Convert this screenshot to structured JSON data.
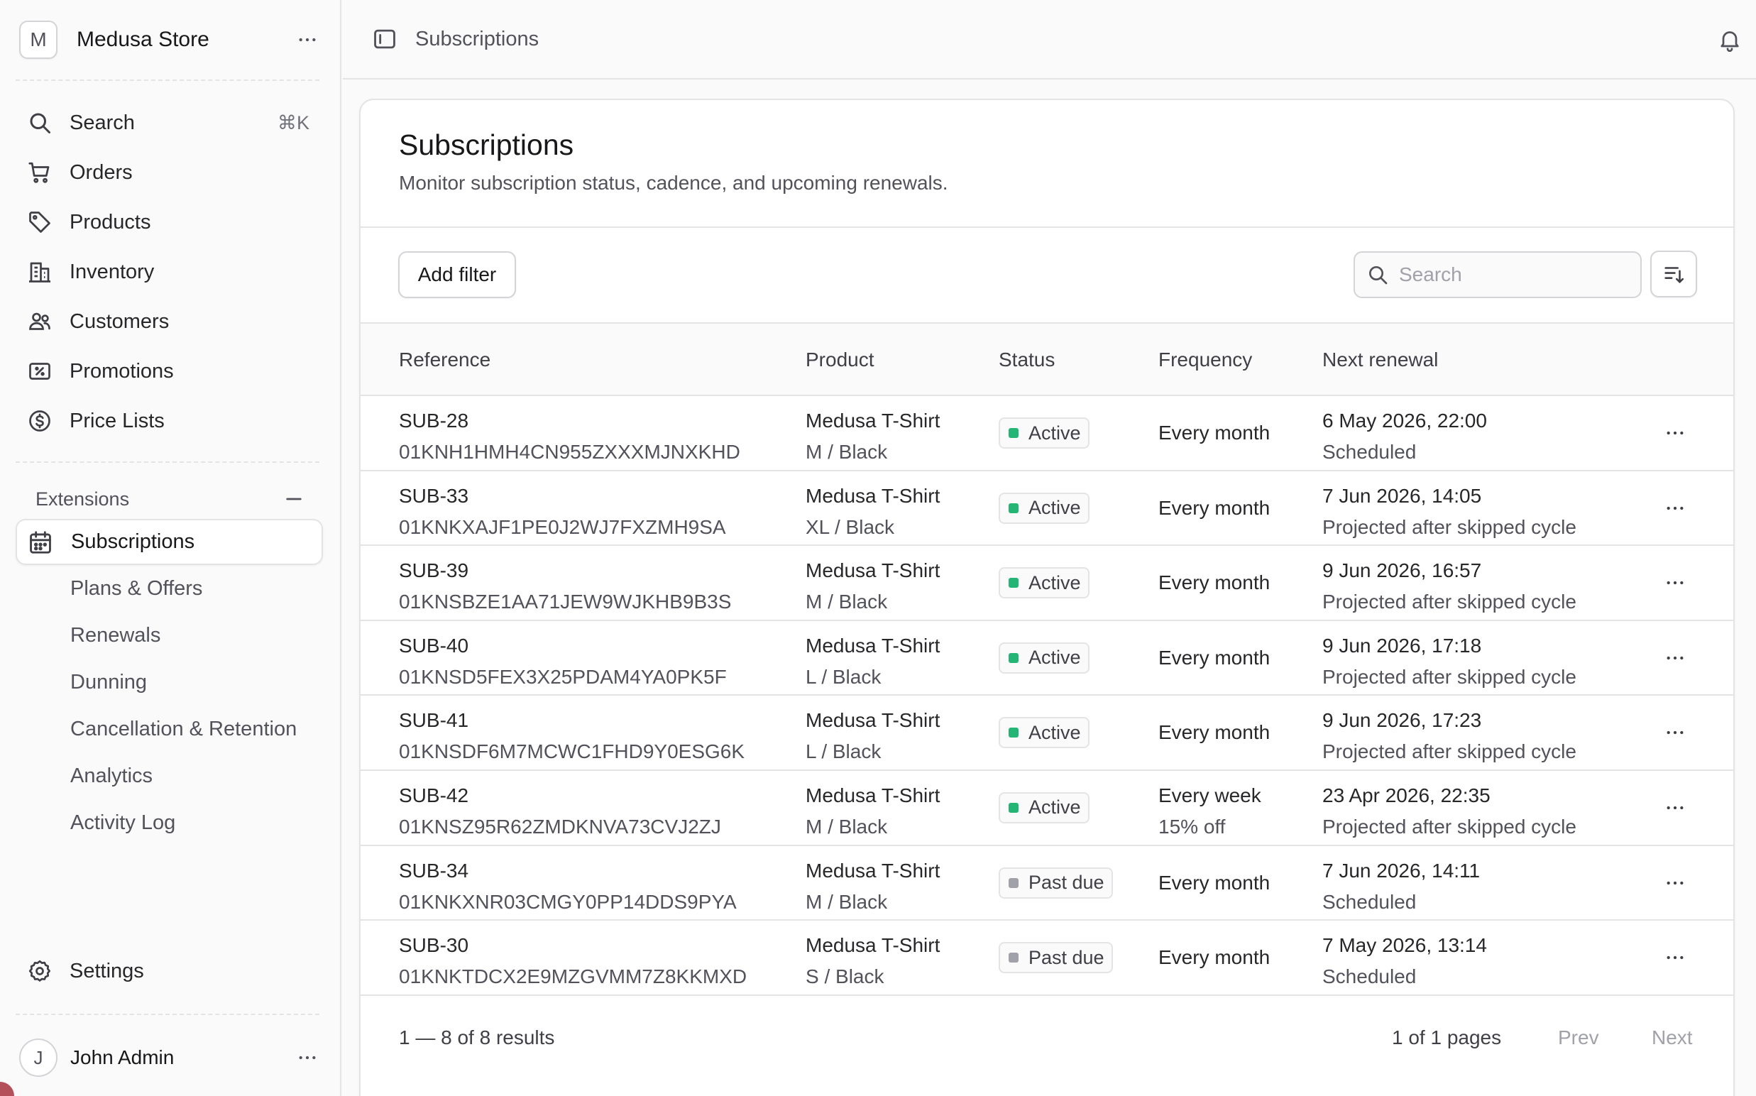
{
  "colors": {
    "status_active": "#22b573",
    "status_past_due": "#a1a1aa"
  },
  "store": {
    "initial": "M",
    "name": "Medusa Store"
  },
  "nav": {
    "search_label": "Search",
    "search_shortcut": "⌘K",
    "items": [
      {
        "label": "Orders",
        "icon": "cart-icon"
      },
      {
        "label": "Products",
        "icon": "tag-icon"
      },
      {
        "label": "Inventory",
        "icon": "building-icon"
      },
      {
        "label": "Customers",
        "icon": "users-icon"
      },
      {
        "label": "Promotions",
        "icon": "receipt-percent-icon"
      },
      {
        "label": "Price Lists",
        "icon": "currency-dollar-icon"
      }
    ]
  },
  "extensions": {
    "header": "Extensions",
    "active": "Subscriptions",
    "subitems": [
      "Plans & Offers",
      "Renewals",
      "Dunning",
      "Cancellation & Retention",
      "Analytics",
      "Activity Log"
    ]
  },
  "settings_label": "Settings",
  "user": {
    "initial": "J",
    "name": "John Admin"
  },
  "topbar": {
    "breadcrumb": "Subscriptions"
  },
  "page": {
    "title": "Subscriptions",
    "subtitle": "Monitor subscription status, cadence, and upcoming renewals.",
    "add_filter": "Add filter",
    "search_placeholder": "Search"
  },
  "table": {
    "columns": [
      "Reference",
      "Product",
      "Status",
      "Frequency",
      "Next renewal"
    ],
    "rows": [
      {
        "ref": "SUB-28",
        "id": "01KNH1HMH4CN955ZXXXMJNXKHD",
        "product": "Medusa T-Shirt",
        "variant": "M / Black",
        "status": "Active",
        "status_kind": "active",
        "frequency": "Every month",
        "freq_note": "",
        "renewal": "6 May 2026, 22:00",
        "renewal_note": "Scheduled"
      },
      {
        "ref": "SUB-33",
        "id": "01KNKXAJF1PE0J2WJ7FXZMH9SA",
        "product": "Medusa T-Shirt",
        "variant": "XL / Black",
        "status": "Active",
        "status_kind": "active",
        "frequency": "Every month",
        "freq_note": "",
        "renewal": "7 Jun 2026, 14:05",
        "renewal_note": "Projected after skipped cycle"
      },
      {
        "ref": "SUB-39",
        "id": "01KNSBZE1AA71JEW9WJKHB9B3S",
        "product": "Medusa T-Shirt",
        "variant": "M / Black",
        "status": "Active",
        "status_kind": "active",
        "frequency": "Every month",
        "freq_note": "",
        "renewal": "9 Jun 2026, 16:57",
        "renewal_note": "Projected after skipped cycle"
      },
      {
        "ref": "SUB-40",
        "id": "01KNSD5FEX3X25PDAM4YA0PK5F",
        "product": "Medusa T-Shirt",
        "variant": "L / Black",
        "status": "Active",
        "status_kind": "active",
        "frequency": "Every month",
        "freq_note": "",
        "renewal": "9 Jun 2026, 17:18",
        "renewal_note": "Projected after skipped cycle"
      },
      {
        "ref": "SUB-41",
        "id": "01KNSDF6M7MCWC1FHD9Y0ESG6K",
        "product": "Medusa T-Shirt",
        "variant": "L / Black",
        "status": "Active",
        "status_kind": "active",
        "frequency": "Every month",
        "freq_note": "",
        "renewal": "9 Jun 2026, 17:23",
        "renewal_note": "Projected after skipped cycle"
      },
      {
        "ref": "SUB-42",
        "id": "01KNSZ95R62ZMDKNVA73CVJ2ZJ",
        "product": "Medusa T-Shirt",
        "variant": "M / Black",
        "status": "Active",
        "status_kind": "active",
        "frequency": "Every week",
        "freq_note": "15% off",
        "renewal": "23 Apr 2026, 22:35",
        "renewal_note": "Projected after skipped cycle"
      },
      {
        "ref": "SUB-34",
        "id": "01KNKXNR03CMGY0PP14DDS9PYA",
        "product": "Medusa T-Shirt",
        "variant": "M / Black",
        "status": "Past due",
        "status_kind": "past_due",
        "frequency": "Every month",
        "freq_note": "",
        "renewal": "7 Jun 2026, 14:11",
        "renewal_note": "Scheduled"
      },
      {
        "ref": "SUB-30",
        "id": "01KNKTDCX2E9MZGVMM7Z8KKMXD",
        "product": "Medusa T-Shirt",
        "variant": "S / Black",
        "status": "Past due",
        "status_kind": "past_due",
        "frequency": "Every month",
        "freq_note": "",
        "renewal": "7 May 2026, 13:14",
        "renewal_note": "Scheduled"
      }
    ]
  },
  "pagination": {
    "count": "1 — 8 of 8 results",
    "pages": "1 of 1 pages",
    "prev": "Prev",
    "next": "Next"
  }
}
